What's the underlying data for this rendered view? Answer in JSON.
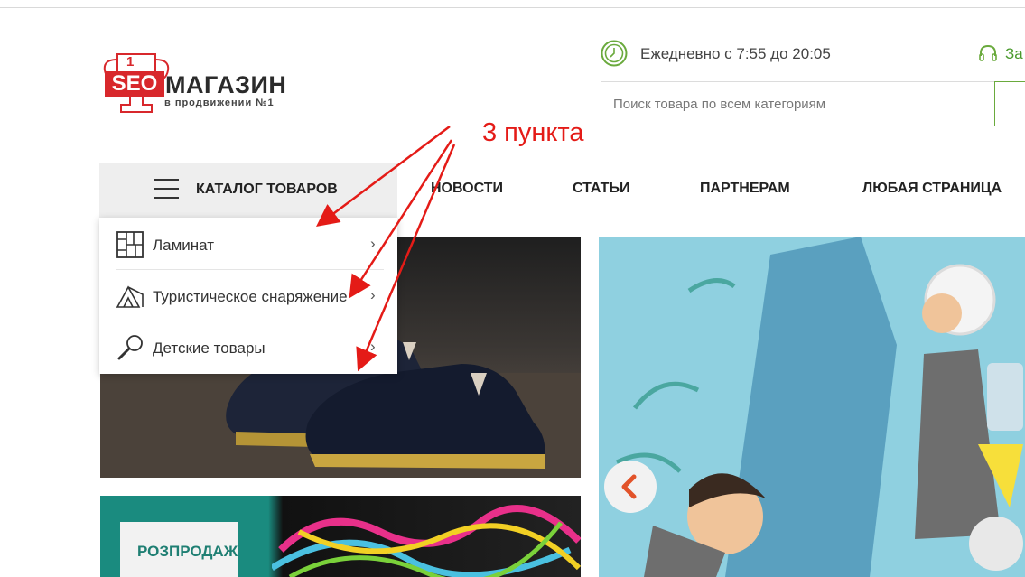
{
  "logo": {
    "seo": "SEO",
    "shop": "МАГАЗИН",
    "tagline": "в продвижении №1",
    "cup_number": "1"
  },
  "header": {
    "schedule": "Ежедневно с 7:55 до 20:05",
    "phone_partial": "За"
  },
  "search": {
    "placeholder": "Поиск товара по всем категориям"
  },
  "catalog": {
    "label": "КАТАЛОГ ТОВАРОВ",
    "items": [
      {
        "label": "Ламинат",
        "icon": "laminate-icon"
      },
      {
        "label": "Туристическое снаряжение",
        "icon": "tent-icon"
      },
      {
        "label": "Детские товары",
        "icon": "rattle-icon"
      }
    ]
  },
  "nav": {
    "items": [
      "НОВОСТИ",
      "СТАТЬИ",
      "ПАРТНЕРАМ",
      "ЛЮБАЯ СТРАНИЦА"
    ]
  },
  "banners": {
    "sale_label": "РОЗПРОДАЖ"
  },
  "annotation": {
    "text": "3 пункта",
    "color": "#e41b17"
  },
  "colors": {
    "brand_red": "#d8282c",
    "accent_green": "#6aaa3d",
    "annotation_red": "#e41b17"
  }
}
